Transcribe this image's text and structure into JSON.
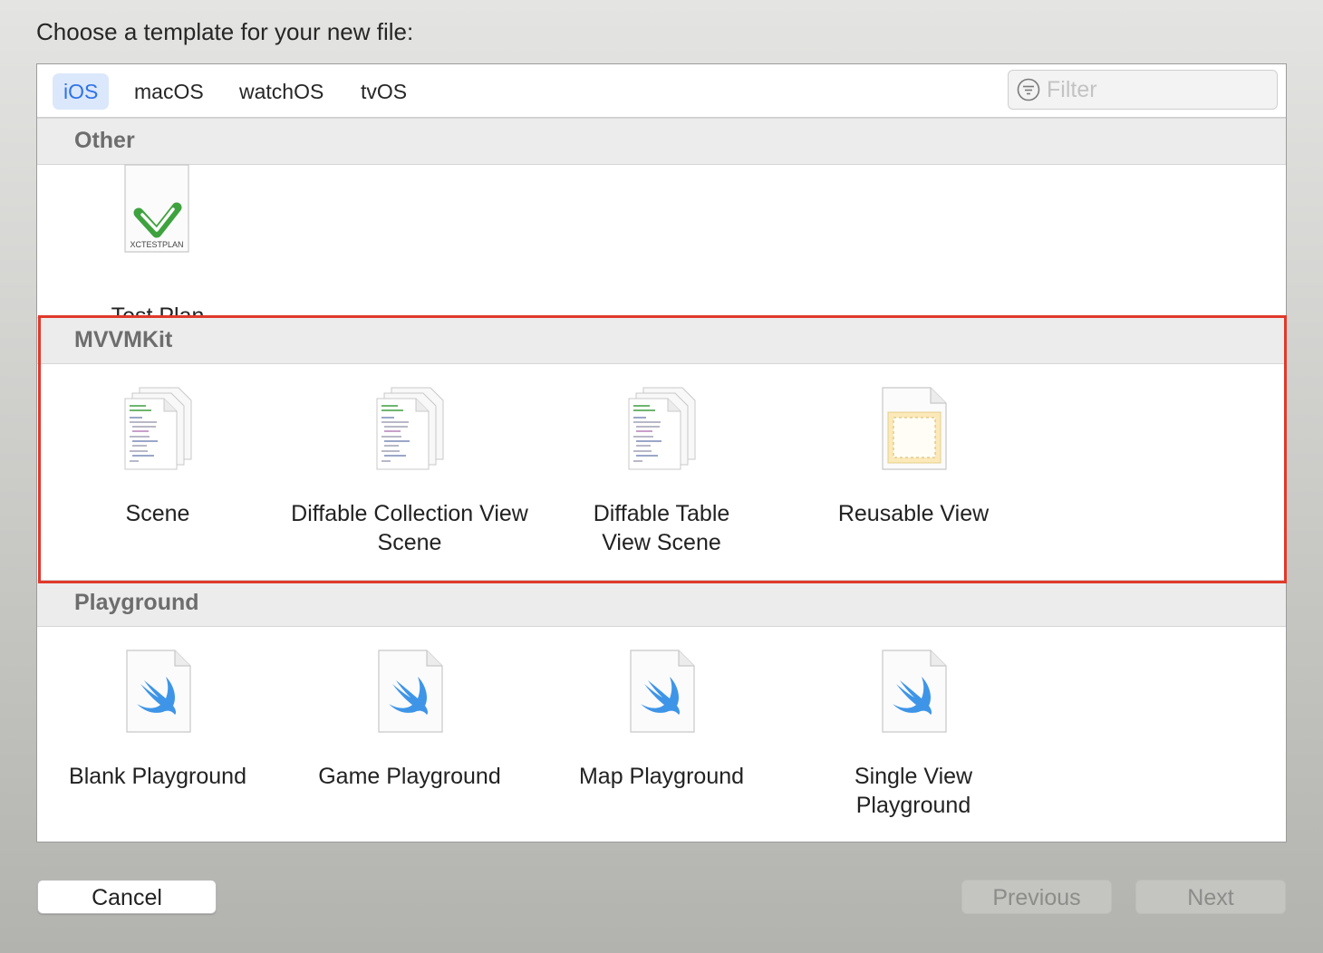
{
  "dialog": {
    "heading": "Choose a template for your new file:"
  },
  "tabs": [
    {
      "label": "iOS",
      "active": true
    },
    {
      "label": "macOS"
    },
    {
      "label": "watchOS"
    },
    {
      "label": "tvOS"
    }
  ],
  "filter": {
    "placeholder": "Filter",
    "value": ""
  },
  "sections": {
    "other": {
      "title": "Other",
      "items": [
        {
          "label": "Test Plan",
          "icon": "xctestplan-file-icon",
          "icon_text": "XCTESTPLAN"
        }
      ]
    },
    "mvvmkit": {
      "title": "MVVMKit",
      "items": [
        {
          "label": "Scene",
          "icon": "code-files-icon"
        },
        {
          "label": "Diffable Collection View Scene",
          "icon": "code-files-icon"
        },
        {
          "label": "Diffable Table View Scene",
          "icon": "code-files-icon"
        },
        {
          "label": "Reusable View",
          "icon": "xib-view-icon"
        }
      ]
    },
    "playground": {
      "title": "Playground",
      "items": [
        {
          "label": "Blank Playground",
          "icon": "swift-playground-icon"
        },
        {
          "label": "Game Playground",
          "icon": "swift-playground-icon"
        },
        {
          "label": "Map Playground",
          "icon": "swift-playground-icon"
        },
        {
          "label": "Single View Playground",
          "icon": "swift-playground-icon"
        }
      ]
    }
  },
  "buttons": {
    "cancel": "Cancel",
    "previous": "Previous",
    "next": "Next"
  },
  "colors": {
    "accent": "#2f73e6",
    "highlight_border": "#e0392b",
    "test_check": "#3ea33e",
    "swift": "#3e95e8"
  }
}
